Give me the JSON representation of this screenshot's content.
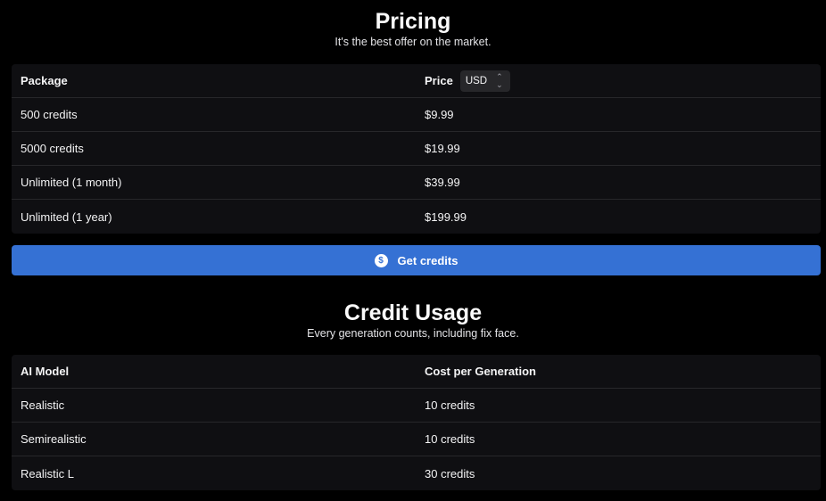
{
  "pricing": {
    "title": "Pricing",
    "subtitle": "It's the best offer on the market.",
    "columns": {
      "package": "Package",
      "price": "Price"
    },
    "currency": {
      "selected": "USD",
      "icon": "chevron-up-down-icon"
    },
    "rows": [
      {
        "package": "500 credits",
        "price": "$9.99"
      },
      {
        "package": "5000 credits",
        "price": "$19.99"
      },
      {
        "package": "Unlimited (1 month)",
        "price": "$39.99"
      },
      {
        "package": "Unlimited (1 year)",
        "price": "$199.99"
      }
    ]
  },
  "cta": {
    "label": "Get credits",
    "icon": "dollar-coin-icon",
    "icon_glyph": "$",
    "color": "#3571d4"
  },
  "usage": {
    "title": "Credit Usage",
    "subtitle": "Every generation counts, including fix face.",
    "columns": {
      "model": "AI Model",
      "cost": "Cost per Generation"
    },
    "rows": [
      {
        "model": "Realistic",
        "cost": "10 credits"
      },
      {
        "model": "Semirealistic",
        "cost": "10 credits"
      },
      {
        "model": "Realistic L",
        "cost": "30 credits"
      }
    ]
  }
}
